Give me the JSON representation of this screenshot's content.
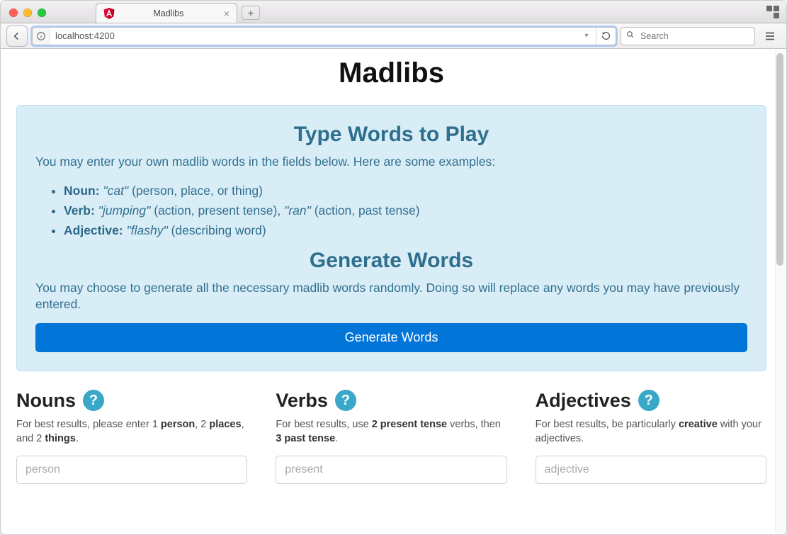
{
  "window": {
    "tab": {
      "title": "Madlibs",
      "favicon": "angular"
    },
    "url": "localhost:4200",
    "search_placeholder": "Search"
  },
  "page": {
    "title": "Madlibs",
    "panel": {
      "heading1": "Type Words to Play",
      "intro": "You may enter your own madlib words in the fields below. Here are some examples:",
      "examples": {
        "noun_label": "Noun:",
        "noun_example": "\"cat\"",
        "noun_paren": "(person, place, or thing)",
        "verb_label": "Verb:",
        "verb_example1": "\"jumping\"",
        "verb_paren1": "(action, present tense),",
        "verb_example2": "\"ran\"",
        "verb_paren2": "(action, past tense)",
        "adj_label": "Adjective:",
        "adj_example": "\"flashy\"",
        "adj_paren": "(describing word)"
      },
      "heading2": "Generate Words",
      "body2": "You may choose to generate all the necessary madlib words randomly. Doing so will replace any words you may have previously entered.",
      "button": "Generate Words"
    },
    "columns": {
      "nouns": {
        "title": "Nouns",
        "hint_prefix": "For best results, please enter 1 ",
        "hint_b1": "person",
        "hint_mid1": ", 2 ",
        "hint_b2": "places",
        "hint_mid2": ", and 2 ",
        "hint_b3": "things",
        "hint_suffix": ".",
        "placeholder": "person"
      },
      "verbs": {
        "title": "Verbs",
        "hint_prefix": "For best results, use ",
        "hint_b1": "2 present tense",
        "hint_mid": " verbs, then ",
        "hint_b2": "3 past tense",
        "hint_suffix": ".",
        "placeholder": "present"
      },
      "adjectives": {
        "title": "Adjectives",
        "hint_prefix": "For best results, be particularly ",
        "hint_b1": "creative",
        "hint_suffix": " with your adjectives.",
        "placeholder": "adjective"
      }
    },
    "help_glyph": "?"
  },
  "colors": {
    "panel_bg": "#d9edf7",
    "panel_border": "#bcdff1",
    "panel_text": "#31708f",
    "primary_button": "#0275d8",
    "help_badge": "#39a7c7"
  }
}
